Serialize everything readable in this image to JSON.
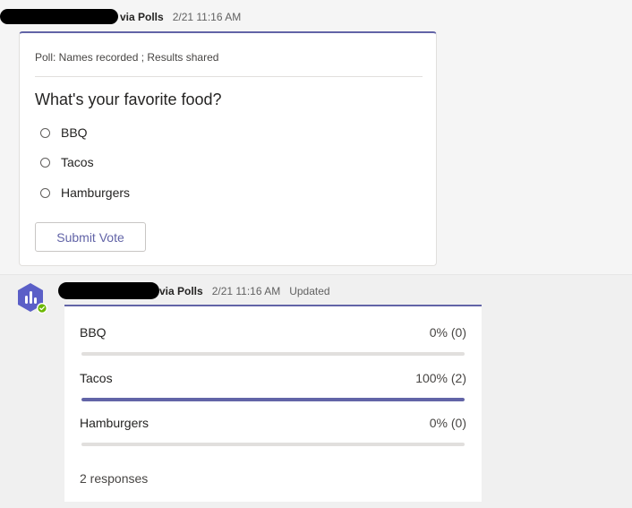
{
  "colors": {
    "accent": "#6264a7",
    "avatar_bg": "#5b5fc7",
    "avatar_badge": "#6bb700"
  },
  "message1": {
    "sender": "via Polls",
    "time": "2/21 11:16 AM"
  },
  "poll_card": {
    "meta": "Poll: Names recorded ; Results shared",
    "question": "What's your favorite food?",
    "options": [
      "BBQ",
      "Tacos",
      "Hamburgers"
    ],
    "submit_label": "Submit Vote"
  },
  "message2": {
    "sender": "via Polls",
    "time": "2/21 11:16 AM",
    "status": "Updated",
    "avatar_icon": "polls-app-icon",
    "badge_icon": "check-badge-icon"
  },
  "results_card": {
    "results": [
      {
        "label": "BBQ",
        "value": "0% (0)",
        "fraction": 0
      },
      {
        "label": "Tacos",
        "value": "100% (2)",
        "fraction": 1
      },
      {
        "label": "Hamburgers",
        "value": "0% (0)",
        "fraction": 0
      }
    ],
    "responses": "2 responses"
  }
}
